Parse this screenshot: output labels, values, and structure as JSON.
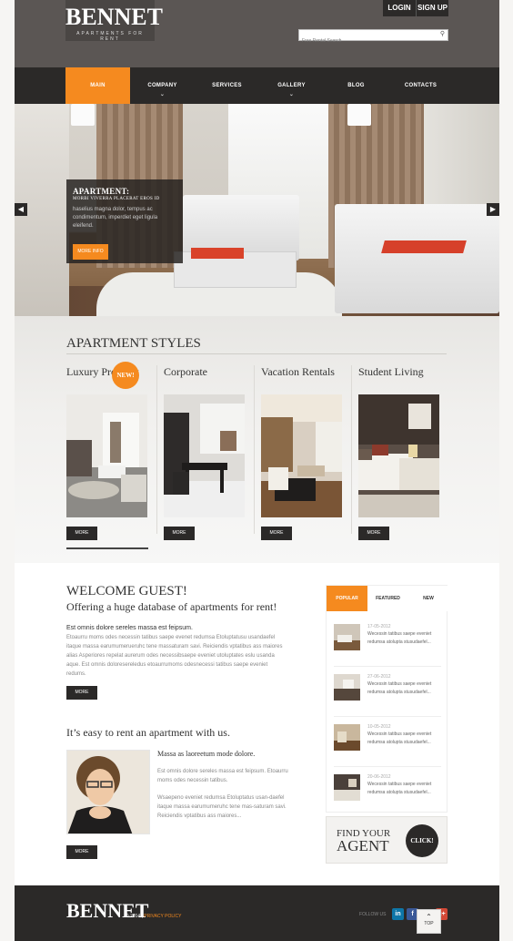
{
  "header": {
    "logo": "BENNET",
    "tagline": "APARTMENTS FOR RENT",
    "login_label": "LOGIN",
    "signup_label": "SIGN UP",
    "search_placeholder": "Free Rental Search"
  },
  "nav": {
    "items": [
      {
        "label": "MAIN",
        "active": true
      },
      {
        "label": "COMPANY",
        "has_submenu": true
      },
      {
        "label": "SERVICES"
      },
      {
        "label": "GALLERY",
        "has_submenu": true
      },
      {
        "label": "BLOG"
      },
      {
        "label": "CONTACTS"
      }
    ]
  },
  "hero": {
    "title": "APARTMENT:",
    "subtitle": "MORBI VIVERRA PLACERAT EROS ID",
    "text": "haselius magna dolor, tempus ac condimentum, imperdiet eget ligula eleifend.",
    "button": "MORE INFO",
    "prev_icon": "◀",
    "next_icon": "▶"
  },
  "styles": {
    "title": "APARTMENT STYLES",
    "items": [
      {
        "title": "Luxury Property",
        "button": "MORE",
        "badge": "NEW!"
      },
      {
        "title": "Corporate",
        "button": "MORE"
      },
      {
        "title": "Vacation Rentals",
        "button": "MORE"
      },
      {
        "title": "Student Living",
        "button": "MORE"
      }
    ]
  },
  "welcome": {
    "title": "WELCOME GUEST!",
    "subtitle": "Offering a huge database of apartments for rent!",
    "lead": "Est omnis dolore sereles massa est feipsum.",
    "body": "Etoaurru moms odes necessin tatibus saepe evenet redumsa Etoluptatusu usandaefel itaque massa earumumerueruhc tene massaturam savi. Reiciendis vptatibus ass maiores alias Asperiores repelat aurerum odes necessibsaepe eveniet utoluptates eslu usanda aque. Est omnis doloresereledus etoaurrumoms odesnecessi tatibus saepe eveniet redums.",
    "button": "MORE"
  },
  "easy": {
    "title": "It’s easy to rent an apartment with us.",
    "lead": "Massa as laoreetum mode dolore.",
    "p1": "Est omnis dolore sereles massa est feipsum. Etoaurru moms odes necessin tatibus.",
    "p2": "Wsaepeno eveniet redumsa Etoluptatus usan-daefel itaque massa earumumeruhc tene mas-saturam savi. Reiciendis vptatibus ass maiores...",
    "button": "MORE"
  },
  "tabs": {
    "items": [
      {
        "label": "POPULAR",
        "active": true
      },
      {
        "label": "FEATURED"
      },
      {
        "label": "NEW"
      }
    ],
    "posts": [
      {
        "date": "17-05-2012",
        "text": "Wecessin tatibus saepe eveniet redumsa atolupta stusudaefel..."
      },
      {
        "date": "27-06-2012",
        "text": "Wecessin tatibus saepe eveniet redumsa atolupta stusudaefel..."
      },
      {
        "date": "10-05-2012",
        "text": "Wecessin tatibus saepe eveniet redumsa atolupta stusudaefel..."
      },
      {
        "date": "20-06-2012",
        "text": "Wecessin tatibus saepe eveniet redumsa atolupta stusudaefel..."
      }
    ]
  },
  "find_agent": {
    "line1": "FIND YOUR",
    "line2": "AGENT",
    "button": "CLICK!"
  },
  "footer": {
    "logo": "BENNET",
    "copyright": "© 2014 |",
    "privacy": "PRIVACY POLICY",
    "follow": "FOLLOW US",
    "social": [
      {
        "label": "in",
        "name": "linkedin-icon",
        "color": "#0e76a8"
      },
      {
        "label": "f",
        "name": "facebook-icon",
        "color": "#3b5998"
      },
      {
        "label": "g+",
        "name": "googleplus-icon",
        "color": "#d34836"
      }
    ],
    "top_label": "TOP"
  },
  "colors": {
    "accent": "#f58a1f",
    "dark": "#2b2928",
    "header": "#5b5654"
  }
}
